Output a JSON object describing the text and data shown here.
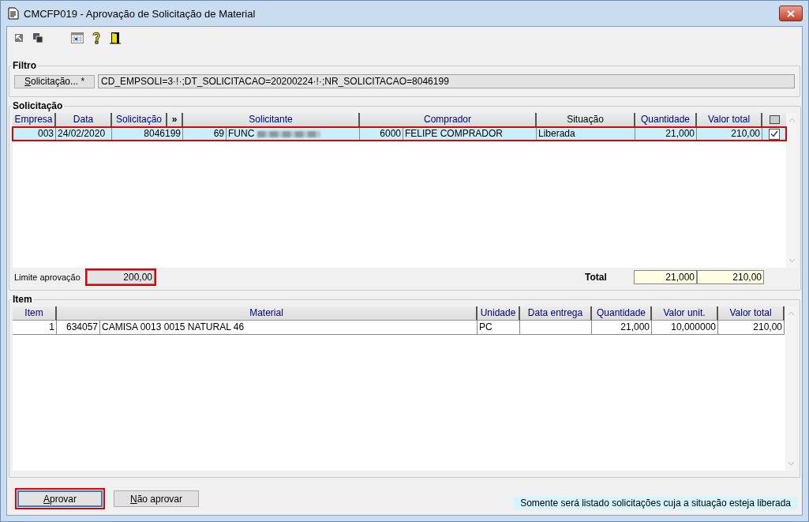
{
  "window": {
    "title": "CMCFP019 - Aprovação de Solicitação de Material"
  },
  "filter": {
    "label": "Filtro",
    "button": "Solicitação... *",
    "value": "CD_EMPSOLI=3·!·;DT_SOLICITACAO=20200224·!·;NR_SOLICITACAO=8046199"
  },
  "solicitacao": {
    "label": "Solicitação",
    "columns": [
      {
        "label": "Empresa",
        "kind": "single",
        "color": "#000080"
      },
      {
        "label": "Data",
        "kind": "single",
        "color": "#000080"
      },
      {
        "label": "Solicitação",
        "kind": "single",
        "color": "#000080",
        "button": "»"
      },
      {
        "label": "Solicitante",
        "kind": "double",
        "color": "#000080"
      },
      {
        "label": "Comprador",
        "kind": "double",
        "color": "#000080"
      },
      {
        "label": "Situação",
        "kind": "single",
        "color": "#000000"
      },
      {
        "label": "Quantidade",
        "kind": "single",
        "color": "#000080"
      },
      {
        "label": "Valor total",
        "kind": "single",
        "color": "#000080"
      },
      {
        "kind": "checkbox"
      }
    ],
    "rows": [
      {
        "selected": true,
        "highlighted": true,
        "checked": true,
        "cells": [
          {
            "text": "003"
          },
          {
            "text": "24/02/2020"
          },
          {
            "text": "8046199"
          },
          {
            "code": "69",
            "text": "FUNC",
            "redacted": true
          },
          {
            "code": "6000",
            "text": "FELIPE COMPRADOR"
          },
          {
            "text": "Liberada"
          },
          {
            "text": "21,000"
          },
          {
            "text": "210,00"
          }
        ]
      }
    ],
    "limit_label": "Limite aprovação",
    "limit_value": "200,00",
    "limit_highlighted": true,
    "total_label": "Total",
    "totals": [
      "21,000",
      "210,00"
    ]
  },
  "item": {
    "label": "Item",
    "columns": [
      {
        "label": "Item",
        "kind": "single",
        "color": "#000080"
      },
      {
        "label": "Material",
        "kind": "double",
        "color": "#000080"
      },
      {
        "label": "Unidade",
        "kind": "single",
        "color": "#000080"
      },
      {
        "label": "Data entrega",
        "kind": "single",
        "color": "#000080"
      },
      {
        "label": "Quantidade",
        "kind": "single",
        "color": "#000080"
      },
      {
        "label": "Valor unit.",
        "kind": "single",
        "color": "#000080"
      },
      {
        "label": "Valor total",
        "kind": "single",
        "color": "#000080"
      }
    ],
    "rows": [
      {
        "cells": [
          {
            "text": "1"
          },
          {
            "code": "634057",
            "text": "CAMISA 0013 0015 NATURAL 46"
          },
          {
            "text": "PC"
          },
          {
            "text": ""
          },
          {
            "text": "21,000"
          },
          {
            "text": "10,000000"
          },
          {
            "text": "210,00"
          }
        ]
      }
    ]
  },
  "buttons": [
    {
      "label": "Aprovar",
      "focused": true,
      "highlighted": true
    },
    {
      "label": "Não aprovar",
      "focused": false,
      "highlighted": false
    }
  ],
  "note": "Somente será listado solicitações cuja a situação esteja liberada"
}
